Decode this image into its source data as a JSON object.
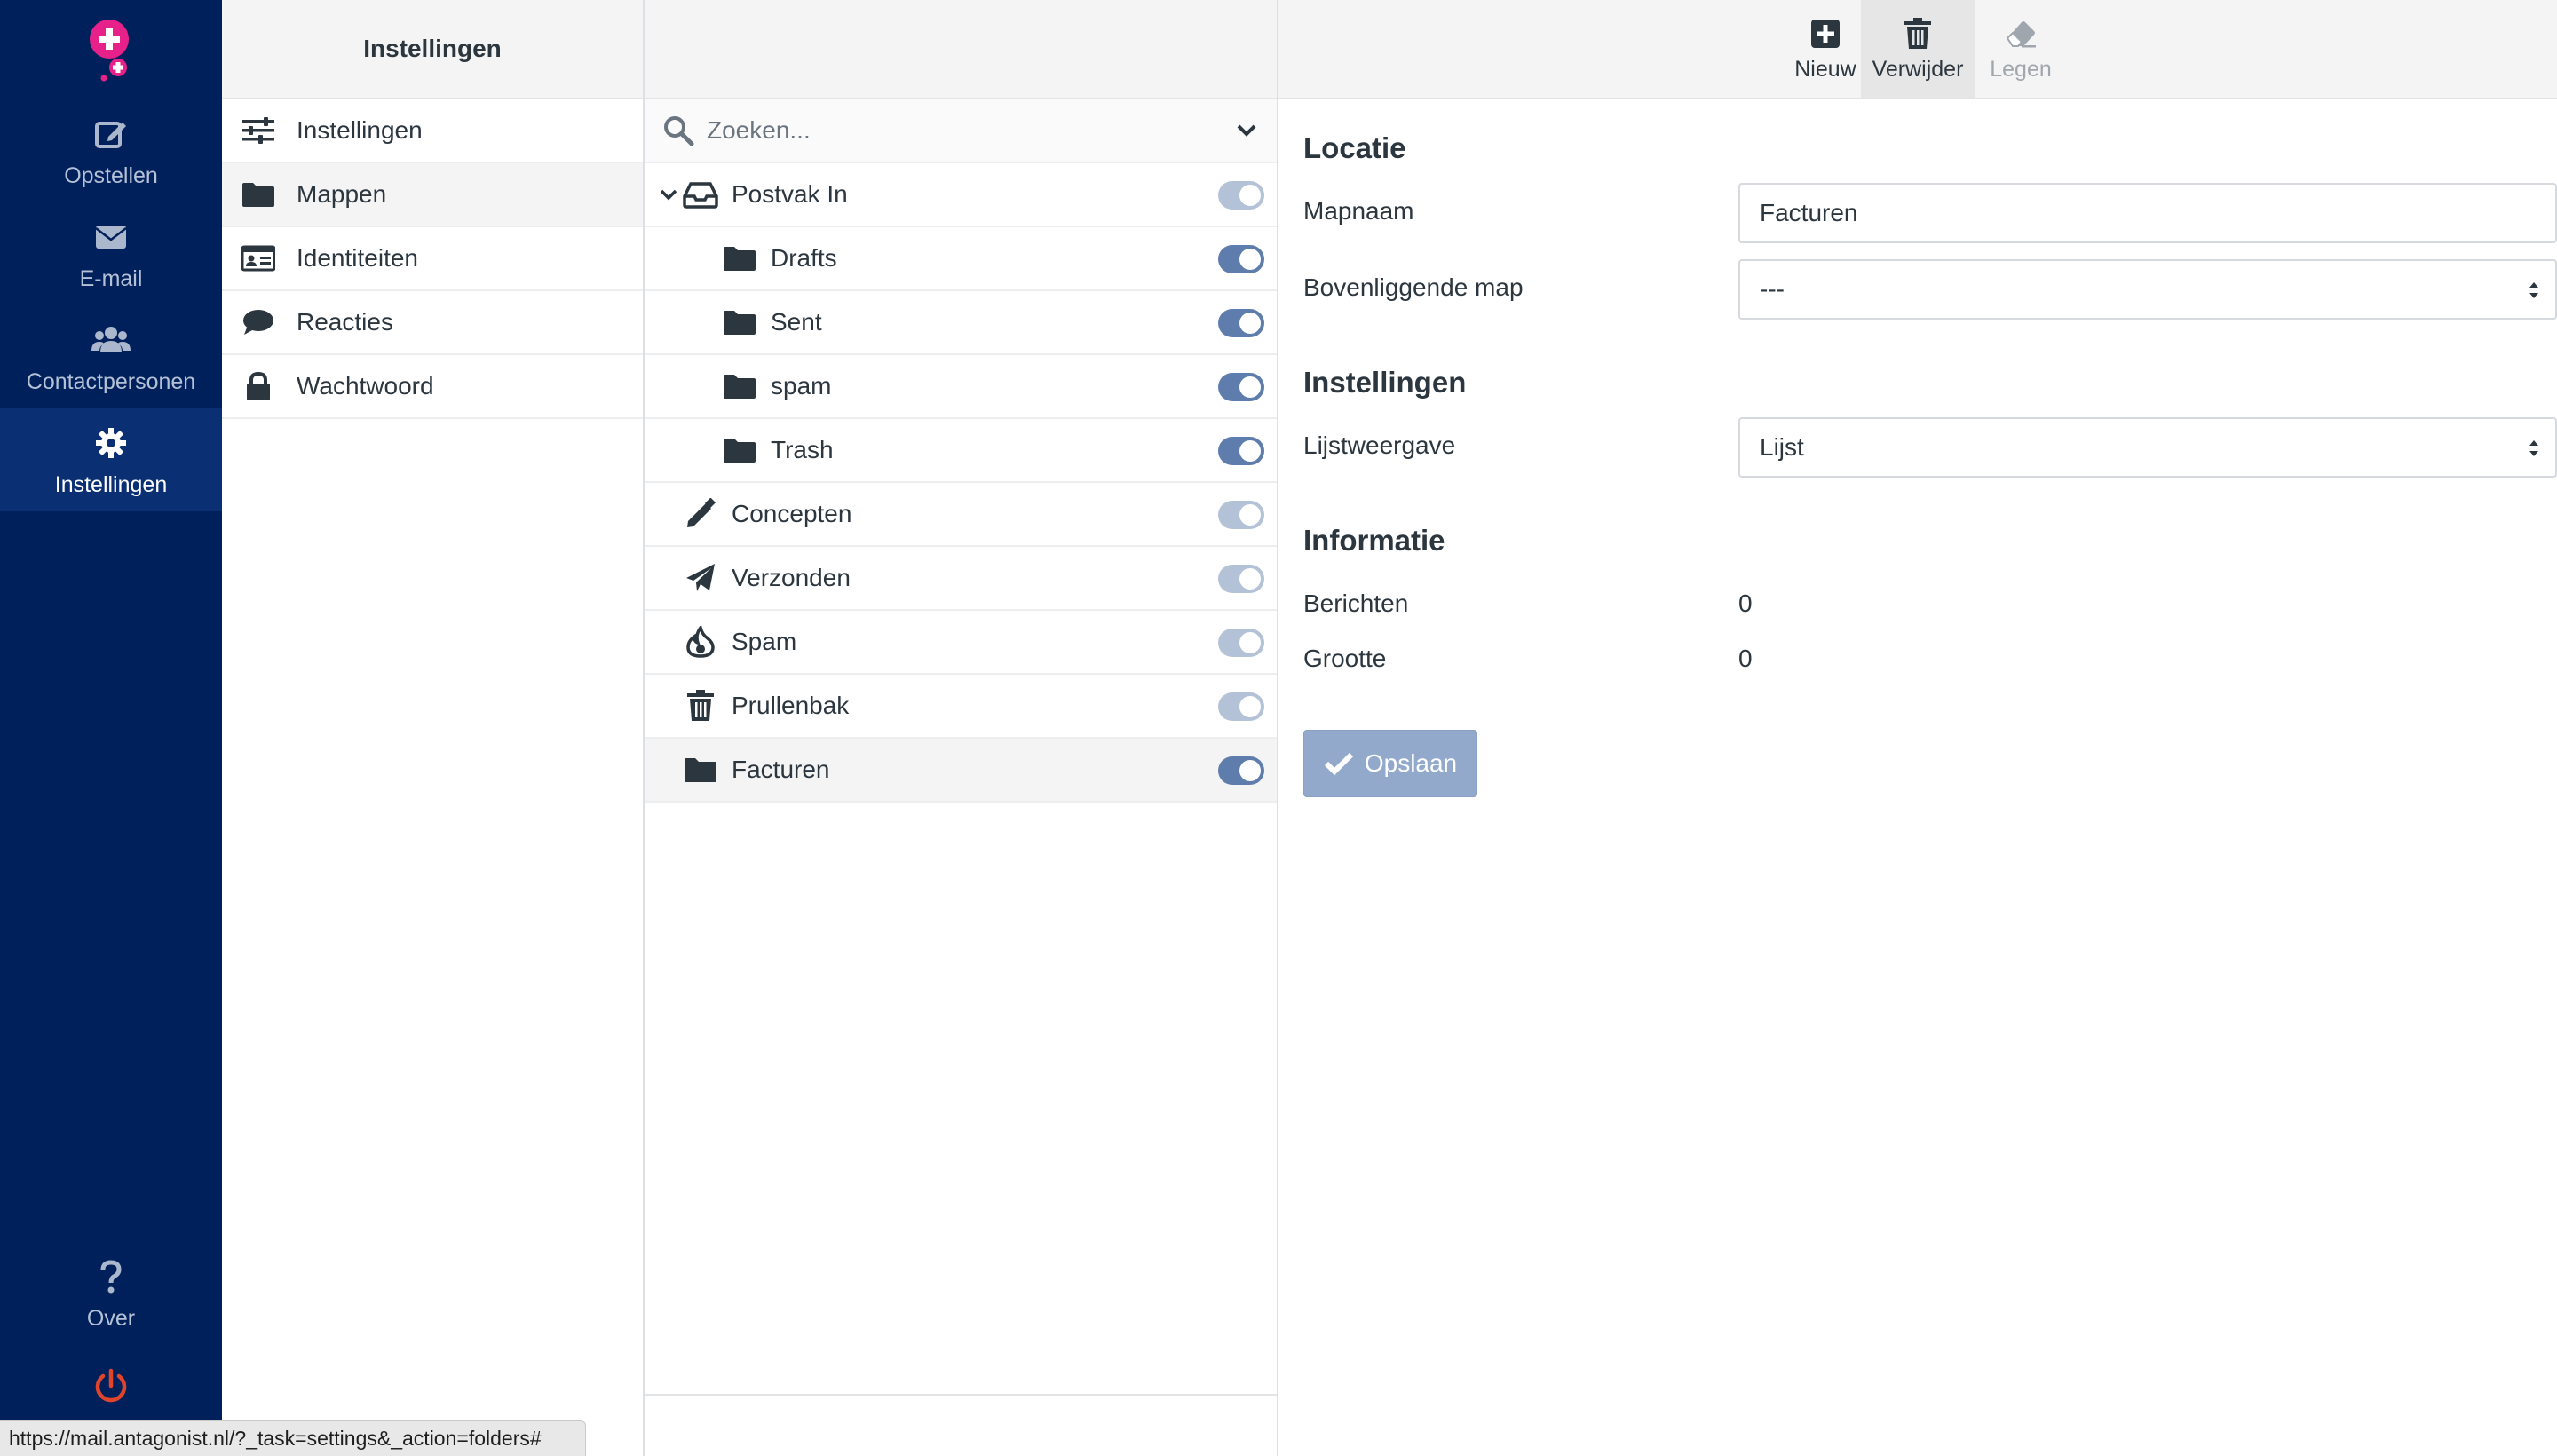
{
  "nav": {
    "items": [
      {
        "label": "Opstellen",
        "icon": "compose-icon"
      },
      {
        "label": "E-mail",
        "icon": "envelope-icon"
      },
      {
        "label": "Contactpersonen",
        "icon": "contacts-icon"
      },
      {
        "label": "Instellingen",
        "icon": "gear-icon",
        "active": true
      }
    ],
    "about_label": "Over",
    "colors": {
      "background": "#00205b",
      "active": "#0a2f73",
      "logo": "#e6228a",
      "logout": "#e0452b"
    }
  },
  "settings": {
    "header": "Instellingen",
    "items": [
      {
        "label": "Instellingen",
        "icon": "sliders-icon"
      },
      {
        "label": "Mappen",
        "icon": "folder-icon",
        "active": true
      },
      {
        "label": "Identiteiten",
        "icon": "id-card-icon"
      },
      {
        "label": "Reacties",
        "icon": "comment-icon"
      },
      {
        "label": "Wachtwoord",
        "icon": "lock-icon"
      }
    ]
  },
  "folders": {
    "search_placeholder": "Zoeken...",
    "items": [
      {
        "name": "Postvak In",
        "icon": "inbox-icon",
        "subscribed": true,
        "locked": true
      },
      {
        "name": "Drafts",
        "icon": "folder-icon",
        "subscribed": true
      },
      {
        "name": "Sent",
        "icon": "folder-icon",
        "subscribed": true
      },
      {
        "name": "spam",
        "icon": "folder-icon",
        "subscribed": true
      },
      {
        "name": "Trash",
        "icon": "folder-icon",
        "subscribed": true
      },
      {
        "name": "Concepten",
        "icon": "pencil-icon",
        "subscribed": true,
        "locked": true
      },
      {
        "name": "Verzonden",
        "icon": "paper-plane-icon",
        "subscribed": true,
        "locked": true
      },
      {
        "name": "Spam",
        "icon": "fire-icon",
        "subscribed": true,
        "locked": true
      },
      {
        "name": "Prullenbak",
        "icon": "trash-icon",
        "subscribed": true,
        "locked": true
      },
      {
        "name": "Facturen",
        "icon": "folder-icon",
        "subscribed": true,
        "active": true
      }
    ]
  },
  "toolbar": {
    "new_label": "Nieuw",
    "delete_label": "Verwijder",
    "empty_label": "Legen"
  },
  "form": {
    "location_title": "Locatie",
    "folder_name_label": "Mapnaam",
    "folder_name_value": "Facturen",
    "parent_label": "Bovenliggende map",
    "parent_value": "---",
    "settings_title": "Instellingen",
    "listview_label": "Lijstweergave",
    "listview_value": "Lijst",
    "info_title": "Informatie",
    "messages_label": "Berichten",
    "messages_value": "0",
    "size_label": "Grootte",
    "size_value": "0",
    "save_label": "Opslaan"
  },
  "statusbar": {
    "url": "https://mail.antagonist.nl/?_task=settings&_action=folders#"
  }
}
